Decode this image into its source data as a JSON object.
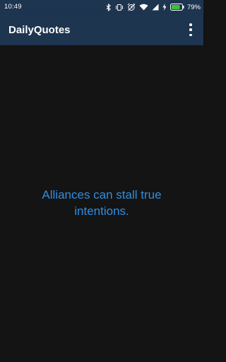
{
  "status_bar": {
    "time": "10:49",
    "battery_percent": "79%",
    "icons": [
      "bluetooth-icon",
      "vibrate-icon",
      "alarm-icon",
      "wifi-icon",
      "signal-icon",
      "charging-icon",
      "battery-icon"
    ]
  },
  "app_bar": {
    "title": "DailyQuotes",
    "overflow_icon": "more-vert-icon"
  },
  "quote": {
    "text": "Alliances can stall true intentions."
  },
  "colors": {
    "app_bar_bg": "#1e3550",
    "background": "#141414",
    "quote_text": "#2f8ee0",
    "battery_fill": "#3cc43c"
  }
}
